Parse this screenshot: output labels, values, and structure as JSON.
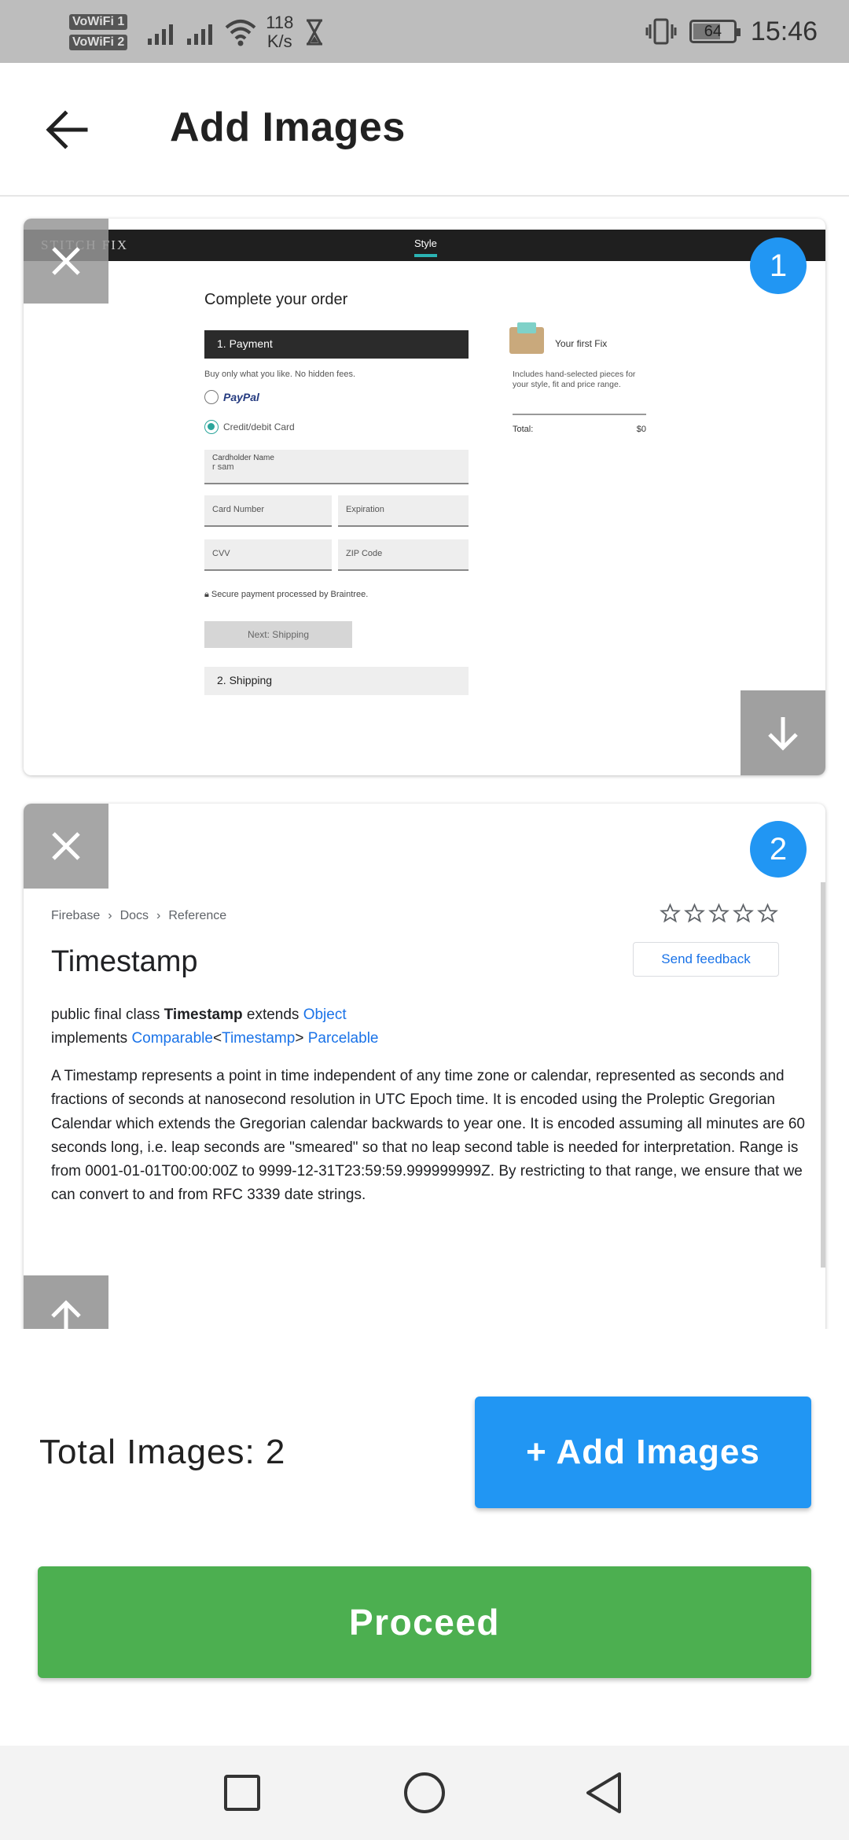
{
  "status_bar": {
    "vowifi_1": "VoWiFi 1",
    "vowifi_2": "VoWiFi 2",
    "speed_value": "118",
    "speed_unit": "K/s",
    "battery": "64",
    "battery_level": 0.64,
    "time": "15:46"
  },
  "app_bar": {
    "title": "Add Images",
    "back_icon": "arrow-left-icon"
  },
  "images": [
    {
      "number": "1",
      "screenshot": {
        "logo": "STITCH FIX",
        "nav_tab": "Style",
        "title": "Complete your order",
        "payment_heading": "1. Payment",
        "note": "Buy only what you like. No hidden fees.",
        "paypal": "PayPal",
        "card_option": "Credit/debit Card",
        "cardholder_label": "Cardholder Name",
        "cardholder_value": "r sam",
        "card_number": "Card Number",
        "expiration": "Expiration",
        "cvv": "CVV",
        "zip": "ZIP Code",
        "secure_text": "Secure payment processed by Braintree.",
        "next_button": "Next: Shipping",
        "shipping_heading": "2. Shipping",
        "fix_title": "Your first Fix",
        "fix_desc": "Includes hand-selected pieces for your style, fit and price range.",
        "total_label": "Total:",
        "total_value": "$0"
      }
    },
    {
      "number": "2",
      "screenshot": {
        "breadcrumbs": [
          "Firebase",
          "Docs",
          "Reference"
        ],
        "title": "Timestamp",
        "feedback_button": "Send feedback",
        "sig_public": "public final class",
        "sig_class": "Timestamp",
        "sig_extends": "extends",
        "sig_object": "Object",
        "sig_implements": "implements",
        "sig_comparable": "Comparable",
        "sig_lt": "<",
        "sig_timestamp": "Timestamp",
        "sig_gt": ">",
        "sig_parcelable": "Parcelable",
        "description": "A Timestamp represents a point in time independent of any time zone or calendar, represented as seconds and fractions of seconds at nanosecond resolution in UTC Epoch time. It is encoded using the Proleptic Gregorian Calendar which extends the Gregorian calendar backwards to year one. It is encoded assuming all minutes are 60 seconds long, i.e. leap seconds are \"smeared\" so that no leap second table is needed for interpretation. Range is from 0001-01-01T00:00:00Z to 9999-12-31T23:59:59.999999999Z. By restricting to that range, we ensure that we can convert to and from RFC 3339 date strings."
      }
    }
  ],
  "footer": {
    "total_images": "Total Images: 2",
    "add_images_button": "+ Add Images",
    "proceed_button": "Proceed"
  },
  "colors": {
    "accent_blue": "#2196f3",
    "proceed_green": "#4caf50",
    "status_bar": "#bdbdbd"
  }
}
